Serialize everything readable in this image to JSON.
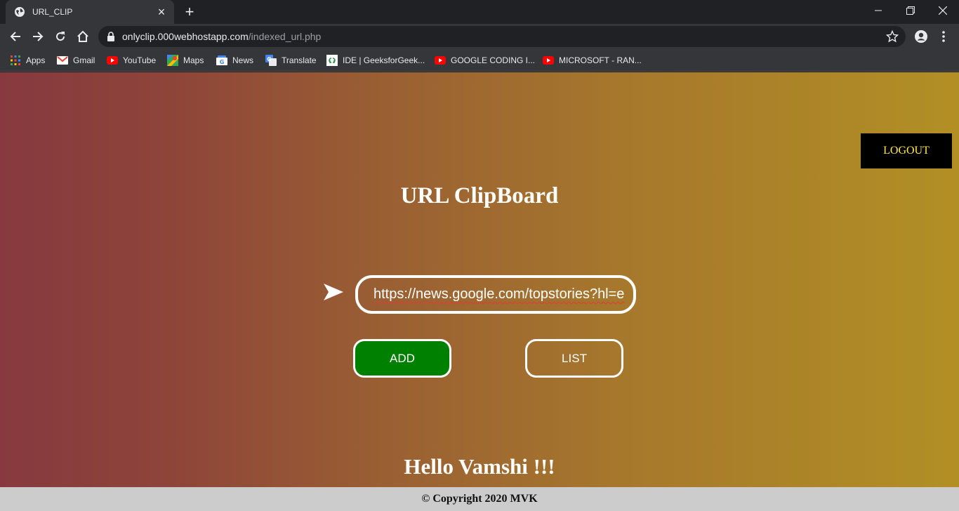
{
  "browser": {
    "tab": {
      "title": "URL_CLIP",
      "close_glyph": "×",
      "favicon": "globe-icon"
    },
    "new_tab_glyph": "+",
    "window_controls": [
      "minimize-icon",
      "restore-icon",
      "close-icon"
    ],
    "address": {
      "host": "onlyclip.000webhostapp.com",
      "path": "/indexed_url.php"
    },
    "bookmarks": [
      {
        "label": "Apps",
        "icon": "apps-grid-icon"
      },
      {
        "label": "Gmail",
        "icon": "gmail-icon"
      },
      {
        "label": "YouTube",
        "icon": "youtube-icon"
      },
      {
        "label": "Maps",
        "icon": "maps-icon"
      },
      {
        "label": "News",
        "icon": "news-icon"
      },
      {
        "label": "Translate",
        "icon": "translate-icon"
      },
      {
        "label": "IDE | GeeksforGeek...",
        "icon": "geeksforgeeks-icon"
      },
      {
        "label": "GOOGLE CODING I...",
        "icon": "youtube-icon"
      },
      {
        "label": "MICROSOFT - RAN...",
        "icon": "youtube-icon"
      }
    ]
  },
  "page": {
    "logout_label": "LOGOUT",
    "title": "URL ClipBoard",
    "url_input_value": "https://news.google.com/topstories?hl=e",
    "add_label": "ADD",
    "list_label": "LIST",
    "greeting": "Hello Vamshi !!!",
    "footer": "© Copyright 2020 MVK",
    "colors": {
      "gradient_start": "#87393f",
      "gradient_end": "#b28f25",
      "add_button": "#008000",
      "logout_bg": "#000000",
      "logout_text": "#ffe84a",
      "footer_bg": "#cccccc"
    }
  }
}
